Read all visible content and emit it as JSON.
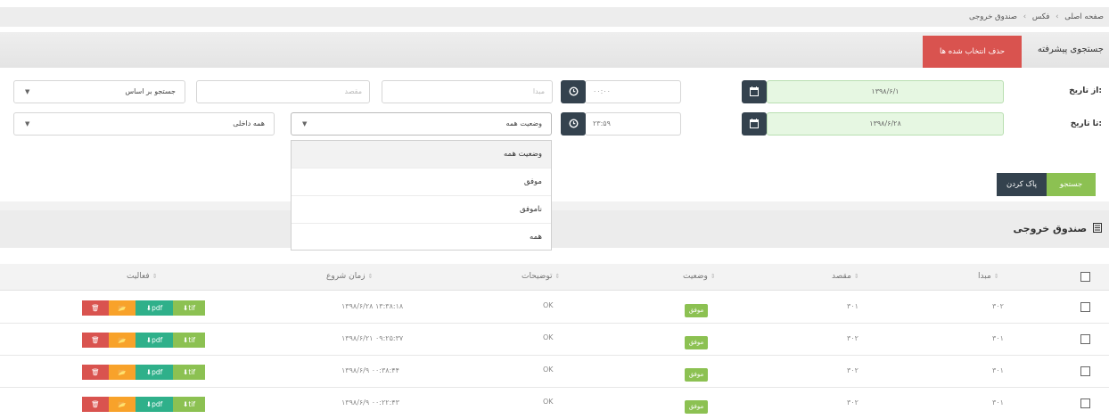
{
  "breadcrumb": {
    "items": [
      "صفحه اصلی",
      "فکس",
      "صندوق خروجی"
    ],
    "sep": "›"
  },
  "header": {
    "title": "جستجوی پیشرفته",
    "delete_selected": "حذف انتخاب شده ها"
  },
  "filters": {
    "from_date_label": "از تاریخ:",
    "to_date_label": "تا تاریخ:",
    "from_date": "۱۳۹۸/۶/۱",
    "to_date": "۱۳۹۸/۶/۲۸",
    "from_time": "۰۰:۰۰",
    "to_time": "۲۳:۵۹",
    "origin_placeholder": "مبدا",
    "dest_placeholder": "مقصد",
    "search_by": "جستجو بر اساس",
    "status_select": "وضعیت همه",
    "internal_select": "همه داخلی",
    "search_button": "جستجو",
    "clear_button": "پاک کردن",
    "calendar_icon": "calendar-icon",
    "clock_icon": "clock-icon"
  },
  "status_dropdown": {
    "options": [
      "وضعیت همه",
      "موفق",
      "ناموفق",
      "همه"
    ],
    "selected": "وضعیت همه"
  },
  "panel": {
    "title": "صندوق خروجی",
    "icon": "list-icon"
  },
  "table": {
    "columns": [
      "مبدا",
      "مقصد",
      "وضعیت",
      "توضیحات",
      "زمان شروع",
      "فعالیت"
    ],
    "rows": [
      {
        "origin": "۳۰۲",
        "dest": "۳۰۱",
        "status": "موفق",
        "desc": "OK",
        "start": "۱۳۹۸/۶/۲۸ ۱۳:۳۸:۱۸"
      },
      {
        "origin": "۳۰۱",
        "dest": "۳۰۲",
        "status": "موفق",
        "desc": "OK",
        "start": "۱۳۹۸/۶/۲۱ ۰۹:۲۵:۳۷"
      },
      {
        "origin": "۳۰۱",
        "dest": "۳۰۲",
        "status": "موفق",
        "desc": "OK",
        "start": "۱۳۹۸/۶/۹ ۰۰:۳۸:۴۴"
      },
      {
        "origin": "۳۰۱",
        "dest": "۳۰۲",
        "status": "موفق",
        "desc": "OK",
        "start": "۱۳۹۸/۶/۹ ۰۰:۲۲:۴۳"
      }
    ],
    "actions": {
      "pdf": "pdf",
      "tif": "tif"
    }
  },
  "colors": {
    "danger": "#d9534f",
    "success": "#8cc152",
    "warning": "#f8a22a",
    "teal": "#2fb08a",
    "dark": "#34424e"
  }
}
